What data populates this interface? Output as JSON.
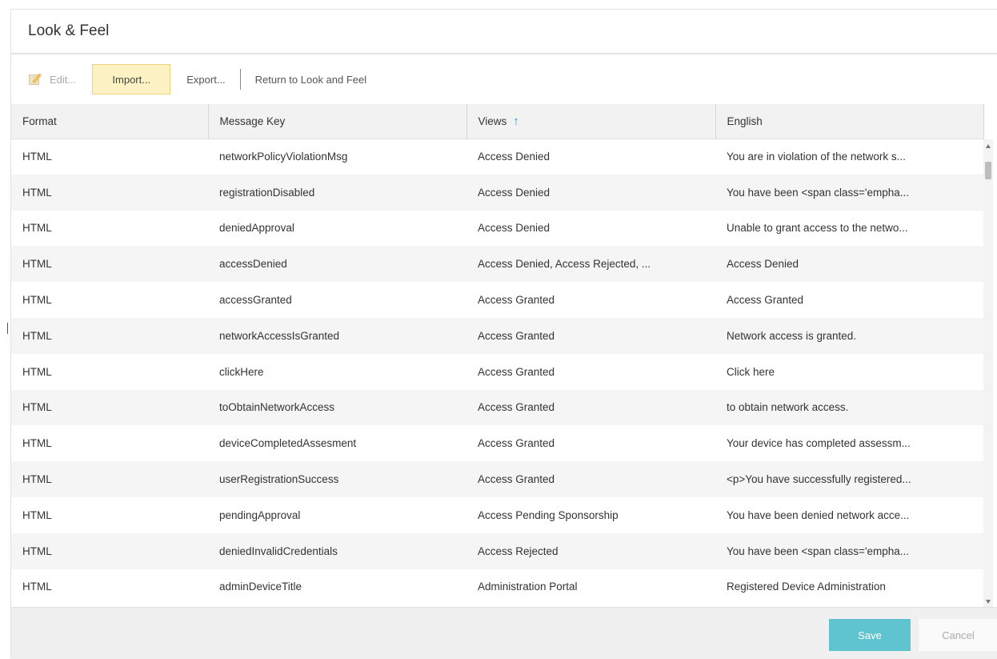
{
  "header": {
    "title": "Look & Feel"
  },
  "toolbar": {
    "edit_label": "Edit...",
    "import_label": "Import...",
    "export_label": "Export...",
    "return_label": "Return to Look and Feel"
  },
  "table": {
    "columns": [
      "Format",
      "Message Key",
      "Views",
      "English"
    ],
    "sorted_column": "Views",
    "sort_direction": "ascending",
    "rows": [
      [
        "HTML",
        "networkPolicyViolationMsg",
        "Access Denied",
        "You are in violation of the network s..."
      ],
      [
        "HTML",
        "registrationDisabled",
        "Access Denied",
        "You have been <span class='empha..."
      ],
      [
        "HTML",
        "deniedApproval",
        "Access Denied",
        "Unable to grant access to the netwo..."
      ],
      [
        "HTML",
        "accessDenied",
        "Access Denied, Access Rejected, ...",
        "Access Denied"
      ],
      [
        "HTML",
        "accessGranted",
        "Access Granted",
        "Access Granted"
      ],
      [
        "HTML",
        "networkAccessIsGranted",
        "Access Granted",
        "Network access is granted."
      ],
      [
        "HTML",
        "clickHere",
        "Access Granted",
        "Click here"
      ],
      [
        "HTML",
        "toObtainNetworkAccess",
        "Access Granted",
        "to obtain network access."
      ],
      [
        "HTML",
        "deviceCompletedAssesment",
        "Access Granted",
        "Your device has completed assessm..."
      ],
      [
        "HTML",
        "userRegistrationSuccess",
        "Access Granted",
        "<p>You have successfully registered..."
      ],
      [
        "HTML",
        "pendingApproval",
        "Access Pending Sponsorship",
        "You have been denied network acce..."
      ],
      [
        "HTML",
        "deniedInvalidCredentials",
        "Access Rejected",
        "You have been <span class='empha..."
      ],
      [
        "HTML",
        "adminDeviceTitle",
        "Administration Portal",
        "Registered Device Administration"
      ]
    ]
  },
  "footer": {
    "save_label": "Save",
    "cancel_label": "Cancel"
  },
  "colors": {
    "accent": "#5fc4d0",
    "sort_arrow": "#1a9ed8",
    "import_highlight": "#fdf2c4"
  }
}
